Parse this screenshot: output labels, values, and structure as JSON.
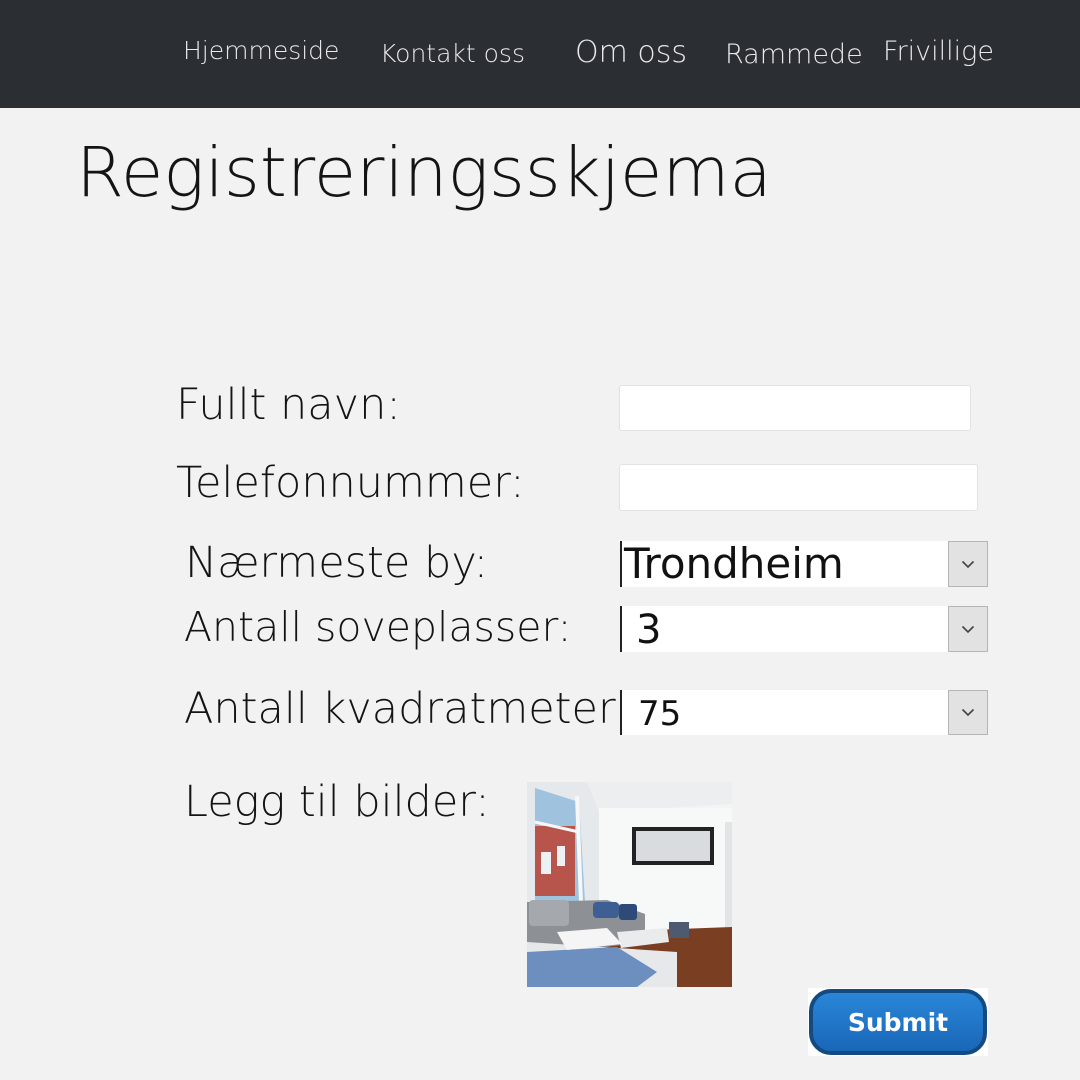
{
  "nav": {
    "items": [
      {
        "label": "Hjemmeside"
      },
      {
        "label": "Kontakt oss"
      },
      {
        "label": "Om oss"
      },
      {
        "label": "Rammede"
      },
      {
        "label": "Frivillige"
      }
    ]
  },
  "page": {
    "title": "Registreringsskjema"
  },
  "form": {
    "full_name": {
      "label": "Fullt navn:",
      "value": ""
    },
    "phone": {
      "label": "Telefonnummer:",
      "value": ""
    },
    "city": {
      "label": "Nærmeste by:",
      "selected": "Trondheim"
    },
    "beds": {
      "label": "Antall soveplasser:",
      "selected": "3"
    },
    "sqm": {
      "label": "Antall kvadratmeter:",
      "selected": "75"
    },
    "images": {
      "label": "Legg til bilder:"
    },
    "submit_label": "Submit"
  },
  "colors": {
    "nav_bg": "#2b2e33",
    "page_bg": "#f2f2f2",
    "submit_bg": "#1f74c6",
    "submit_border": "#134a82"
  },
  "icons": {
    "select_arrow": "chevron-down-icon"
  }
}
